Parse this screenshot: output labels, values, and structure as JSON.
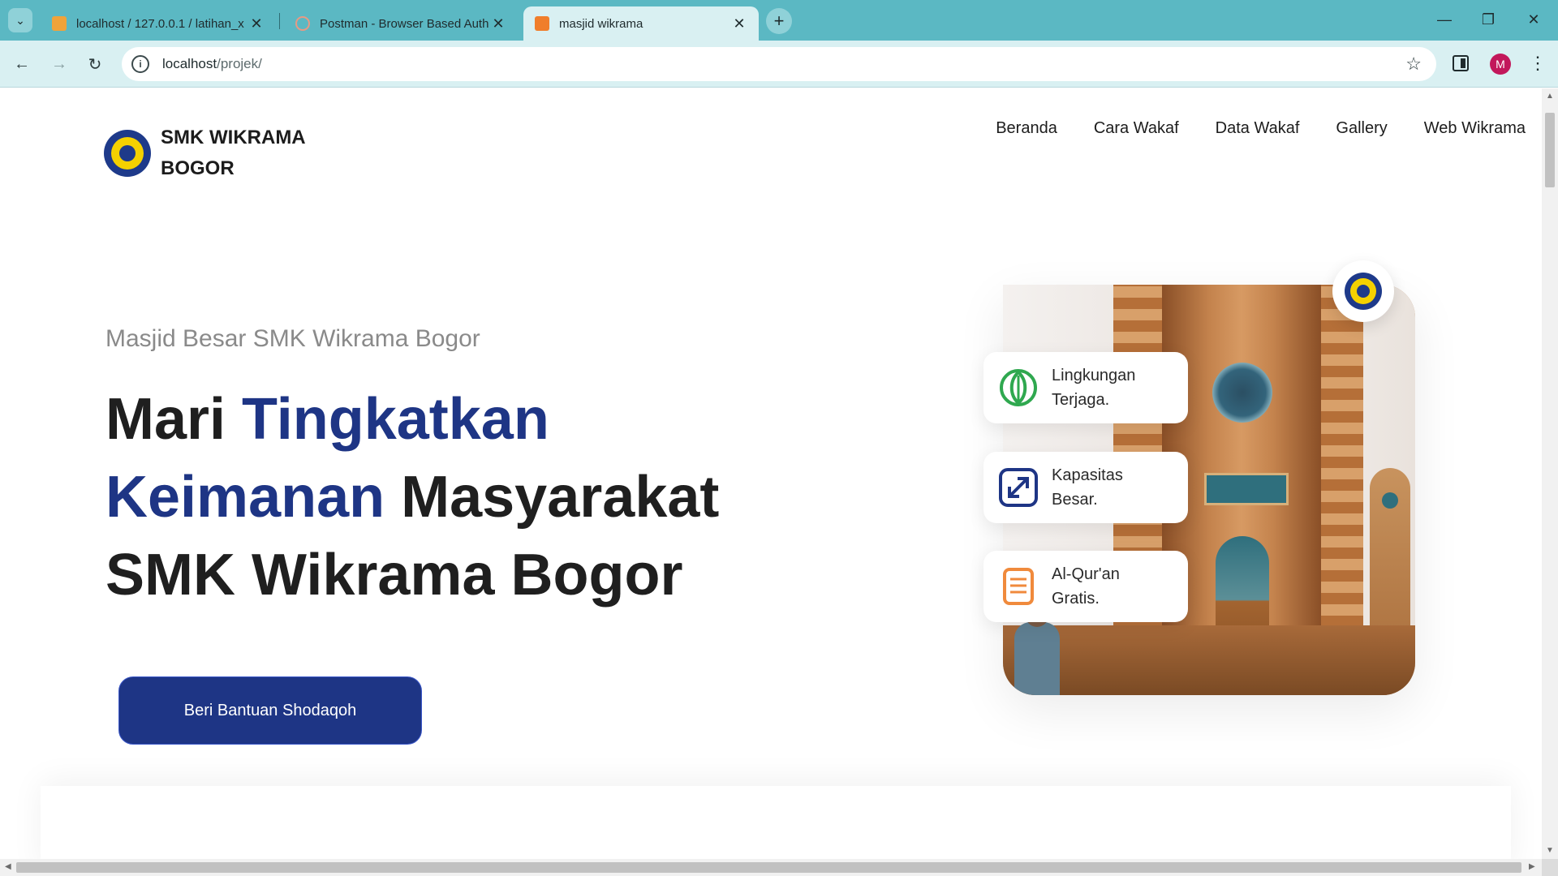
{
  "browser": {
    "tabs": [
      {
        "title": "localhost / 127.0.0.1 / latihan_x",
        "favicon_color": "#f0a33a"
      },
      {
        "title": "Postman - Browser Based Auth",
        "favicon_color": "#f56a3b"
      },
      {
        "title": "masjid wikrama",
        "favicon_color": "#f07e2b",
        "active": true
      }
    ],
    "new_tab_label": "+",
    "address": {
      "host": "localhost",
      "path": "/projek/"
    },
    "profile_initial": "M"
  },
  "site": {
    "brand": "SMK WIKRAMA BOGOR",
    "nav": [
      "Beranda",
      "Cara Wakaf",
      "Data Wakaf",
      "Gallery",
      "Web Wikrama"
    ]
  },
  "hero": {
    "subtitle": "Masjid Besar SMK Wikrama Bogor",
    "title_part1": "Mari ",
    "title_hl1": "Tingkatkan Keimanan",
    "title_part2": " Masyarakat SMK Wikrama Bogor",
    "cta_label": "Beri Bantuan Shodaqoh"
  },
  "features": [
    {
      "label": "Lingkungan Terjaga.",
      "icon": "leaf-icon",
      "color": "#2fa84f"
    },
    {
      "label": "Kapasitas Besar.",
      "icon": "expand-icon",
      "color": "#1e3585"
    },
    {
      "label": "Al-Qur'an Gratis.",
      "icon": "book-icon",
      "color": "#f08a3c"
    }
  ],
  "colors": {
    "brand_blue": "#1e3585",
    "chrome_teal": "#5bb8c3",
    "chrome_light": "#d9f0f2"
  }
}
